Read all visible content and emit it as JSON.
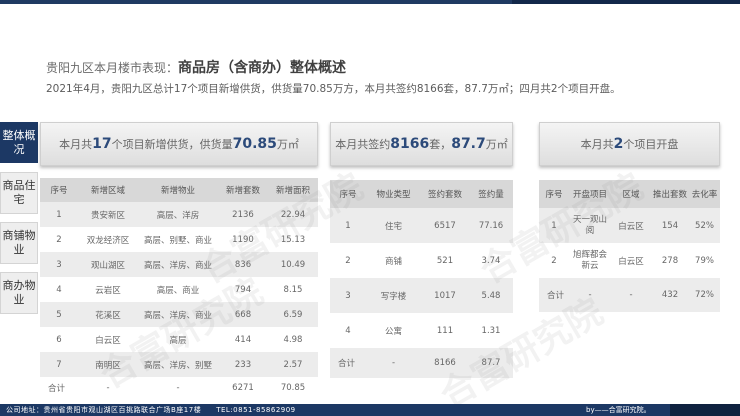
{
  "header": {
    "title_prefix": "贵阳九区本月楼市表现：",
    "title_strong": "商品房（含商办）整体概述",
    "subtitle": "2021年4月，贵阳九区总计17个项目新增供货，供货量70.85万方，本月共签约8166套，87.7万㎡；四月共2个项目开盘。"
  },
  "side_tabs": [
    {
      "label": "整体概况",
      "active": true
    },
    {
      "label": "商品住宅",
      "active": false
    },
    {
      "label": "商铺物业",
      "active": false
    },
    {
      "label": "商办物业",
      "active": false
    }
  ],
  "card_supply": {
    "pre": "本月共",
    "n1": "17",
    "mid": "个项目新增供货，供货量",
    "n2": "70.85",
    "post": "万㎡",
    "headers": [
      "序号",
      "新增区域",
      "新增物业",
      "新增套数",
      "新增面积"
    ],
    "rows": [
      [
        "1",
        "贵安新区",
        "高层、洋房",
        "2136",
        "22.94"
      ],
      [
        "2",
        "双龙经济区",
        "高层、别墅、商业",
        "1190",
        "15.13"
      ],
      [
        "3",
        "观山湖区",
        "高层、洋房、商业",
        "836",
        "10.49"
      ],
      [
        "4",
        "云岩区",
        "高层、商业",
        "794",
        "8.15"
      ],
      [
        "5",
        "花溪区",
        "高层、洋房、商业",
        "668",
        "6.59"
      ],
      [
        "6",
        "白云区",
        "高层",
        "414",
        "4.98"
      ],
      [
        "7",
        "南明区",
        "高层、洋房、别墅",
        "233",
        "2.57"
      ],
      [
        "合计",
        "-",
        "-",
        "6271",
        "70.85"
      ]
    ]
  },
  "card_sign": {
    "pre": "本月共签约",
    "n1": "8166",
    "mid": "套，",
    "n2": "87.7",
    "post": "万㎡",
    "headers": [
      "序号",
      "物业类型",
      "签约套数",
      "签约量"
    ],
    "rows": [
      [
        "1",
        "住宅",
        "6517",
        "77.16"
      ],
      [
        "2",
        "商铺",
        "521",
        "3.74"
      ],
      [
        "3",
        "写字楼",
        "1017",
        "5.48"
      ],
      [
        "4",
        "公寓",
        "111",
        "1.31"
      ],
      [
        "合计",
        "-",
        "8166",
        "87.7"
      ]
    ]
  },
  "card_open": {
    "pre": "本月共",
    "n1": "2",
    "post": "个项目开盘",
    "headers": [
      "序号",
      "开盘项目",
      "区域",
      "推出套数",
      "去化率"
    ],
    "rows": [
      [
        "1",
        "天一观山阅",
        "白云区",
        "154",
        "52%"
      ],
      [
        "2",
        "旭辉都会新云",
        "白云区",
        "278",
        "79%"
      ],
      [
        "合计",
        "-",
        "-",
        "432",
        "72%"
      ]
    ]
  },
  "watermark": "合富研究院",
  "footer": {
    "address": "公司地址：贵州省贵阳市观山湖区百挑路联合广场B座17楼　　TEL:0851-85862909",
    "brand": "by——合富研究院。"
  }
}
